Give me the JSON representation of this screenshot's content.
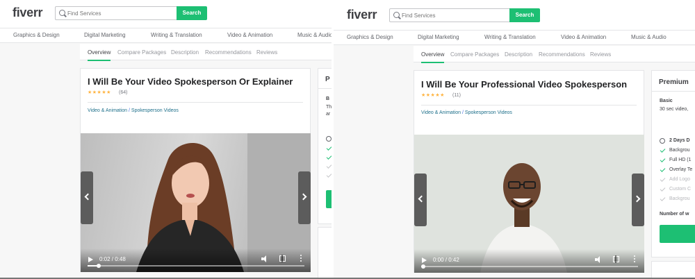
{
  "left": {
    "logo": "fiverr",
    "search": {
      "placeholder": "Find Services",
      "button": "Search"
    },
    "categories": [
      "Graphics & Design",
      "Digital Marketing",
      "Writing & Translation",
      "Video & Animation",
      "Music & Audio"
    ],
    "tabs": [
      "Overview",
      "Compare Packages",
      "Description",
      "Recommendations",
      "Reviews"
    ],
    "gig": {
      "title": "I Will Be Your Video Spokesperson Or Explainer",
      "stars": "★★★★★",
      "rating_count": "(64)",
      "breadcrumb": [
        "Video & Animation",
        "Spokesperson Videos"
      ]
    },
    "video": {
      "time": "0:02 / 0:48",
      "progress": 0.05
    },
    "package": {
      "head": "P",
      "basic": "B",
      "desc1": "Th",
      "desc2": "ar"
    }
  },
  "right": {
    "logo": "fiverr",
    "search": {
      "placeholder": "Find Services",
      "button": "Search"
    },
    "categories": [
      "Graphics & Design",
      "Digital Marketing",
      "Writing & Translation",
      "Video & Animation",
      "Music & Audio"
    ],
    "tabs": [
      "Overview",
      "Compare Packages",
      "Description",
      "Recommendations",
      "Reviews"
    ],
    "gig": {
      "title": "I Will Be Your Professional Video Spokesperson",
      "stars": "★★★★★",
      "rating_count": "(11)",
      "breadcrumb": [
        "Video & Animation",
        "Spokesperson Videos"
      ]
    },
    "video": {
      "time": "0:00 / 0:42",
      "progress": 0.01
    },
    "package": {
      "head": "Premium",
      "basic": "Basic",
      "desc": "30 sec video,",
      "delivery": "2 Days D",
      "features": [
        {
          "label": "Backgrou",
          "included": true
        },
        {
          "label": "Full HD (1",
          "included": true
        },
        {
          "label": "Overlay Te",
          "included": true
        },
        {
          "label": "Add Logo",
          "included": false
        },
        {
          "label": "Custom C",
          "included": false
        },
        {
          "label": "Backgrou",
          "included": false
        }
      ],
      "number_of": "Number of w"
    }
  },
  "colors": {
    "accent": "#1dbf73",
    "star": "#ffb33e",
    "link": "#1d6f8a"
  }
}
